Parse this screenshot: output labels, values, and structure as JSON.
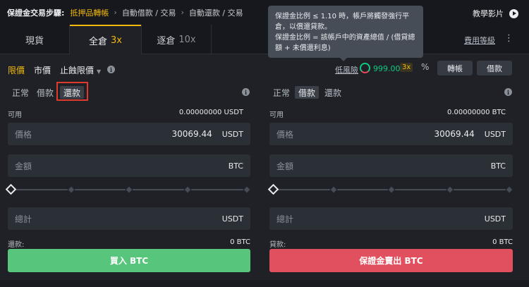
{
  "steps": {
    "title": "保證金交易步驟:",
    "items": [
      "抵押品轉帳",
      "自動借款 / 交易",
      "自動還款 / 交易"
    ],
    "tutorial": "教學影片"
  },
  "tabs": [
    {
      "label": "現貨",
      "lev": ""
    },
    {
      "label": "全倉",
      "lev": "3x"
    },
    {
      "label": "逐倉",
      "lev": "10x"
    }
  ],
  "fee_link": "費用等級",
  "more_icon": "more-vertical-icon",
  "order_types": {
    "limit": "限價",
    "market": "市價",
    "stop_limit": "止蝕限價"
  },
  "risk": {
    "label": "低風險",
    "value": "999.00",
    "leverage": "3x"
  },
  "actions": {
    "transfer": "轉帳",
    "borrow": "借款"
  },
  "tooltip": {
    "line1": "保證金比例 ≤ 1.10 時，帳戶將觸發強行平",
    "line2": "倉，以償還貸款。",
    "line3": "保證金比例 = 該帳戶中的資產總值 / (借貸總",
    "line4": "額 + 未償還利息)"
  },
  "left": {
    "modes": [
      "正常",
      "借款",
      "還款"
    ],
    "available_label": "可用",
    "available_value": "0.00000000 USDT",
    "price_label": "價格",
    "price_value": "30069.44",
    "price_unit": "USDT",
    "amount_label": "金額",
    "amount_unit": "BTC",
    "total_label": "總計",
    "total_unit": "USDT",
    "loan_label": "還款:",
    "loan_value": "0 BTC",
    "button": "買入 BTC"
  },
  "right": {
    "modes": [
      "正常",
      "借款",
      "還款"
    ],
    "available_label": "可用",
    "available_value": "0.00000000 BTC",
    "price_label": "價格",
    "price_value": "30069.44",
    "price_unit": "USDT",
    "amount_label": "金額",
    "amount_unit": "BTC",
    "total_label": "總計",
    "total_unit": "USDT",
    "loan_label": "貸款:",
    "loan_value": "0 BTC",
    "button": "保證金賣出 BTC"
  },
  "colors": {
    "accent": "#f0b90b",
    "buy": "#58c57c",
    "sell": "#e0505e",
    "highlight": "#e03a2f"
  }
}
